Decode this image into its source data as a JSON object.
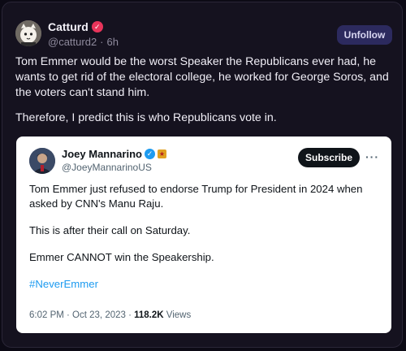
{
  "post": {
    "author_name": "Catturd",
    "handle": "@catturd2",
    "separator": "·",
    "time": "6h",
    "follow_label": "Unfollow",
    "paragraph1": "Tom Emmer would be the worst Speaker the Republicans ever had, he wants to get rid of the electoral college, he worked for George Soros, and the voters can't stand him.",
    "paragraph2": "Therefore, I predict this is who Republicans vote in."
  },
  "quote": {
    "author_name": "Joey Mannarino",
    "handle": "@JoeyMannarinoUS",
    "subscribe_label": "Subscribe",
    "more_label": "···",
    "paragraph1": "Tom Emmer just refused to endorse Trump for President in 2024 when asked by CNN's Manu Raju.",
    "paragraph2": "This is after their call on Saturday.",
    "paragraph3": "Emmer CANNOT win the Speakership.",
    "hashtag": "#NeverEmmer",
    "timestamp": "6:02 PM · Oct 23, 2023 · ",
    "views_count": "118.2K",
    "views_label": " Views"
  },
  "icons": {
    "catturd_verified": "verified-badge-icon",
    "joey_verified": "verified-badge-icon",
    "joey_affiliate": "affiliate-badge-icon"
  },
  "colors": {
    "background": "#15121f",
    "follow_button": "#2c2a5e",
    "verified_red": "#e8345a",
    "verified_blue": "#1d9bf0",
    "hashtag": "#1d9bf0"
  }
}
